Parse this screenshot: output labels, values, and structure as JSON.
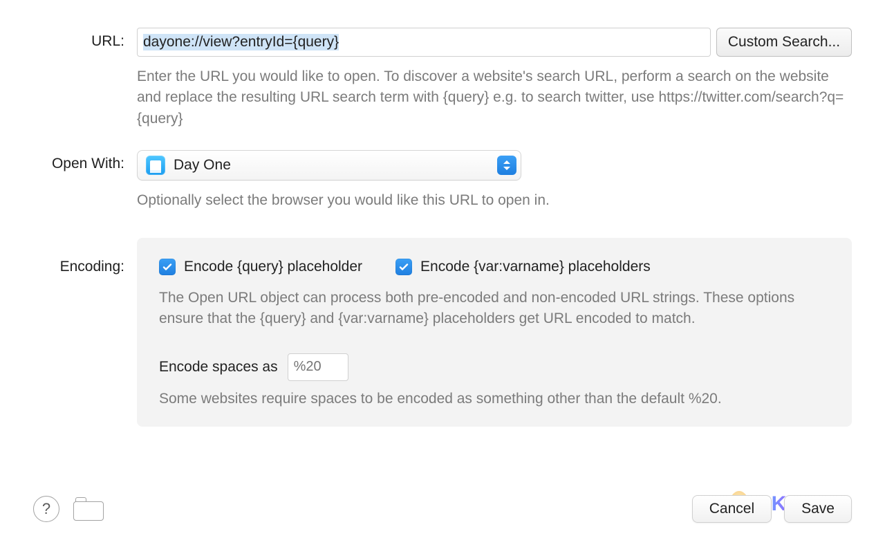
{
  "url": {
    "label": "URL:",
    "value": "dayone://view?entryId={query}",
    "custom_search_label": "Custom Search...",
    "help": "Enter the URL you would like to open. To discover a website's search URL, perform a search on the website and replace the resulting URL search term with {query} e.g. to search twitter, use https://twitter.com/search?q={query}"
  },
  "open_with": {
    "label": "Open With:",
    "app_name": "Day One",
    "help": "Optionally select the browser you would like this URL to open in."
  },
  "encoding": {
    "label": "Encoding:",
    "check_query": "Encode {query} placeholder",
    "check_var": "Encode {var:varname} placeholders",
    "help": "The Open URL object can process both pre-encoded and non-encoded URL strings. These options ensure that the {query} and {var:varname} placeholders get URL encoded to match.",
    "spaces_label": "Encode spaces as",
    "spaces_placeholder": "%20",
    "spaces_help": "Some websites require spaces to be encoded as something other than the default %20."
  },
  "footer": {
    "help_symbol": "?",
    "cancel": "Cancel",
    "save": "Save"
  },
  "watermark": "PKMER"
}
